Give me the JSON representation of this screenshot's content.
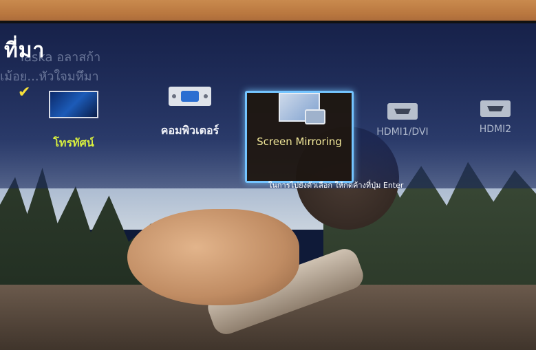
{
  "header": {
    "title": "ที่มา",
    "ghost_line1": "laska  อลาสก้า",
    "ghost_line2": "เม้อย...หัวใจมหึมา"
  },
  "sources": [
    {
      "label": "โทรทัศน์",
      "icon": "tv-icon",
      "checked": true
    },
    {
      "label": "คอมพิวเตอร์",
      "icon": "computer-icon"
    },
    {
      "label": "Screen Mirroring",
      "icon": "screen-mirroring-icon",
      "selected": true
    },
    {
      "label": "HDMI1/DVI",
      "icon": "hdmi-icon"
    },
    {
      "label": "HDMI2",
      "icon": "hdmi-icon"
    }
  ],
  "hint": "ในการไปยังตัวเลือก ให้กดค้างที่ปุ่ม Enter",
  "colors": {
    "selection_border": "#74c4ff",
    "active_source_label": "#d9f03e",
    "selected_label": "#f2e89a"
  }
}
